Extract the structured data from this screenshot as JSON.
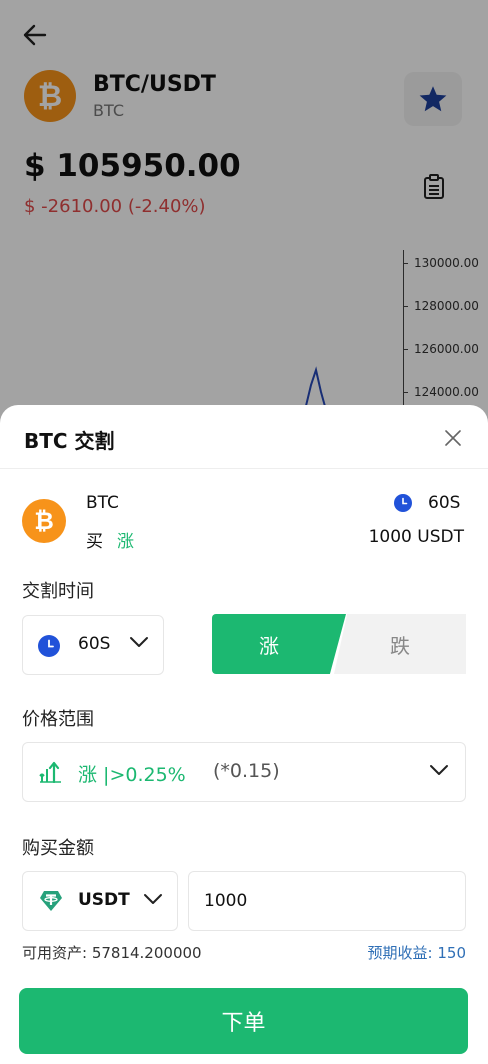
{
  "header": {
    "pair": "BTC/USDT",
    "coin": "BTC",
    "price": "$ 105950.00",
    "change": "$ -2610.00 (-2.40%)"
  },
  "chart": {
    "ticks": [
      "130000.00",
      "128000.00",
      "126000.00",
      "124000.00"
    ]
  },
  "sheet": {
    "title": "BTC 交割",
    "summary": {
      "coin": "BTC",
      "direction_label": "买",
      "direction_value": "涨",
      "time": "60S",
      "amount": "1000 USDT"
    },
    "time_section": {
      "label": "交割时间",
      "value": "60S"
    },
    "direction": {
      "up": "涨",
      "down": "跌"
    },
    "range_section": {
      "label": "价格范围",
      "main": "涨 |>0.25%",
      "multiplier": "(*0.15)"
    },
    "amount_section": {
      "label": "购买金额",
      "currency": "USDT",
      "value": "1000"
    },
    "available": "可用资产: 57814.200000",
    "expected": "预期收益: 150",
    "submit": "下单"
  },
  "colors": {
    "green": "#1cb871",
    "red": "#e04a4a",
    "blue": "#2f6fb6",
    "btc": "#f7931a"
  }
}
